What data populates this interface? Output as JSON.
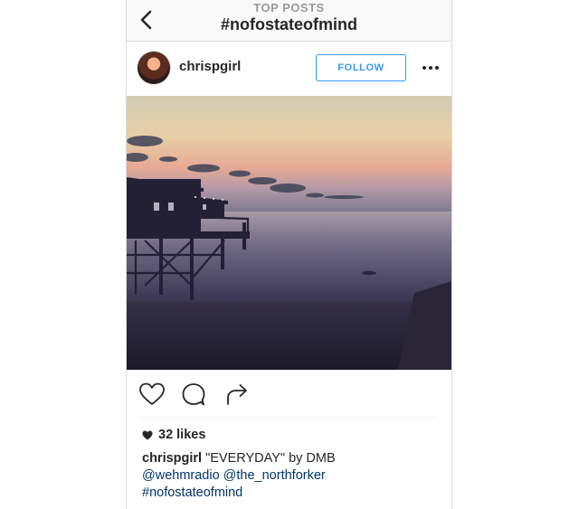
{
  "nav": {
    "subtitle": "TOP POSTS",
    "title": "#nofostateofmind"
  },
  "post": {
    "username": "chrispgirl",
    "follow_label": "FOLLOW",
    "likes_label": "32 likes",
    "caption": {
      "username": "chrispgirl",
      "text": "\"EVERYDAY\" by DMB",
      "mention_1": "@wehmradio",
      "mention_2": "@the_northforker",
      "hashtag": "#nofostateofmind"
    }
  },
  "icons": {
    "back": "chevron-left-icon",
    "more": "more-horizontal-icon",
    "like": "heart-outline-icon",
    "comment": "comment-bubble-icon",
    "share": "share-arrow-icon",
    "likes_heart": "heart-filled-icon"
  },
  "colors": {
    "accent": "#3897f0",
    "link": "#003569",
    "text": "#262626",
    "muted": "#999999"
  }
}
